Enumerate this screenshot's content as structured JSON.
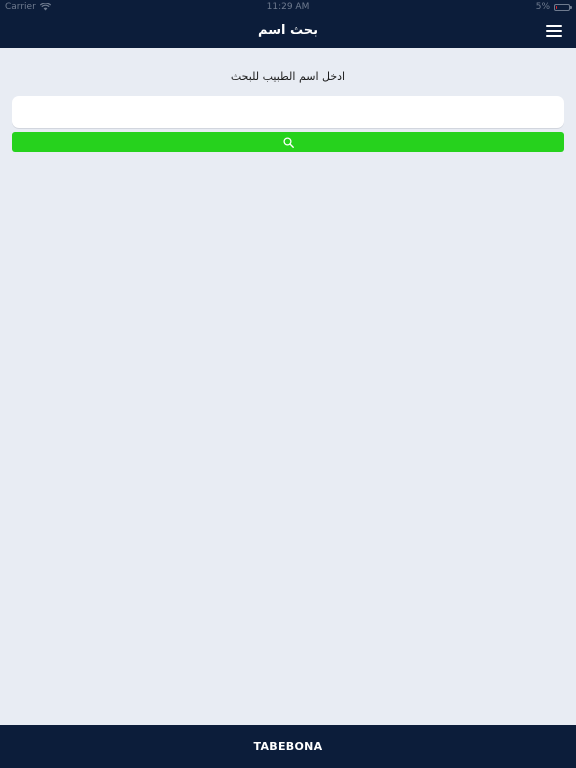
{
  "status_bar": {
    "carrier": "Carrier",
    "time": "11:29 AM",
    "battery_text": "5%",
    "battery_level": 0.05,
    "wifi_icon": "wifi-icon",
    "battery_icon": "battery-icon"
  },
  "header": {
    "title": "بحث اسم",
    "menu_icon": "hamburger-menu-icon"
  },
  "search": {
    "prompt": "ادخل اسم الطبيب للبحث",
    "value": "",
    "placeholder": "",
    "button_icon": "search-icon"
  },
  "footer": {
    "label": "TABEBONA"
  },
  "colors": {
    "bar_background": "#0c1d3a",
    "page_background": "#e8ecf3",
    "search_button": "#26d21d",
    "battery_low": "#e0262b"
  }
}
